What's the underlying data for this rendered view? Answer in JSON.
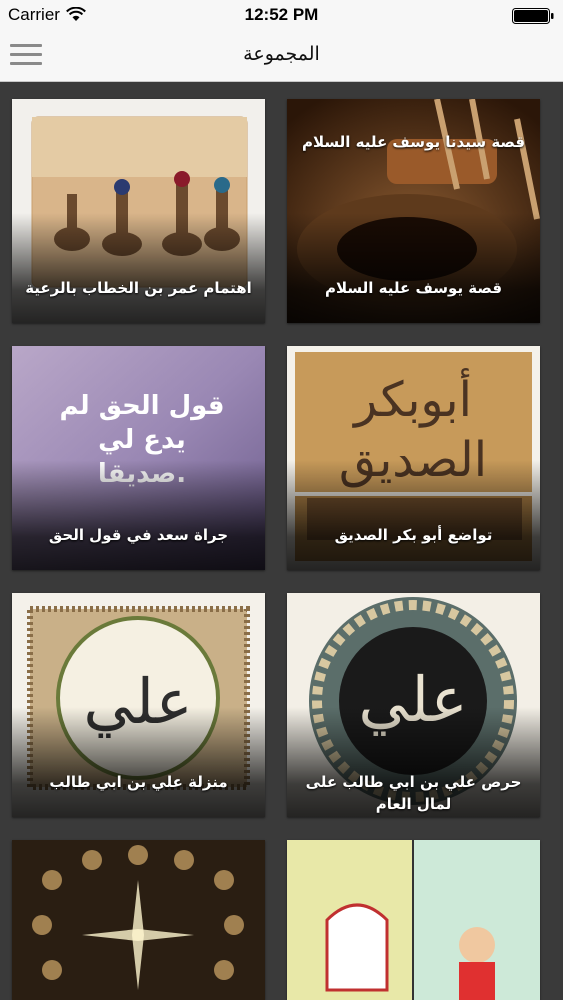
{
  "status_bar": {
    "carrier": "Carrier",
    "time": "12:52 PM"
  },
  "nav": {
    "title": "المجموعة"
  },
  "cards": [
    {
      "caption": "قصة يوسف عليه السلام",
      "overlay_text": "قصة سيدنا يوسف عليه السلام"
    },
    {
      "caption": "اهتمام عمر بن الخطاب بالرعية"
    },
    {
      "caption": "تواضع أبو بكر الصديق",
      "overlay_text": "أبوبكر الصديق"
    },
    {
      "caption": "جراة سعد في قول الحق",
      "overlay_text": "قول الحق لم يدع لي صديقا."
    },
    {
      "caption": "حرص علي بن ابي طالب على لمال العام",
      "overlay_text": "علي"
    },
    {
      "caption": "منزلة علي بن ابي طالب",
      "overlay_text": "علي"
    },
    {
      "caption": ""
    },
    {
      "caption": ""
    }
  ],
  "colors": {
    "background": "#3a3a3a",
    "bar": "#f7f7f7"
  }
}
